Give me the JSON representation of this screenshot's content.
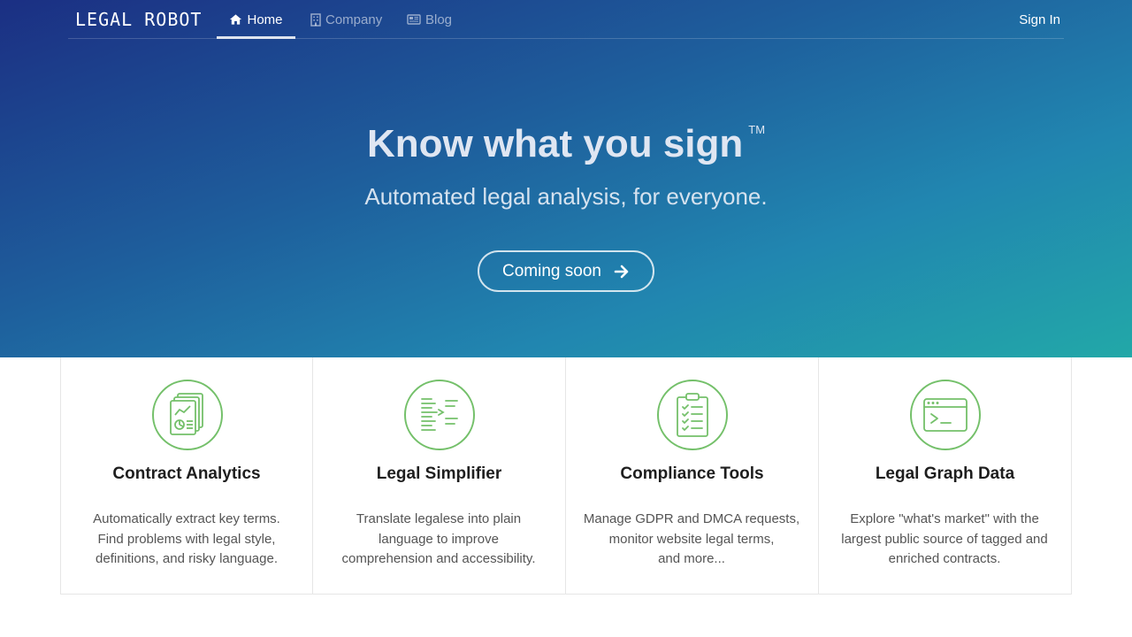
{
  "brand": {
    "logo": "LEGAL ROBOT"
  },
  "nav": {
    "items": [
      {
        "label": "Home",
        "icon": "home-icon",
        "active": true
      },
      {
        "label": "Company",
        "icon": "building-icon",
        "active": false
      },
      {
        "label": "Blog",
        "icon": "newspaper-icon",
        "active": false
      }
    ],
    "sign_in": "Sign In"
  },
  "hero": {
    "title": "Know what you sign",
    "trademark": "TM",
    "subtitle": "Automated legal analysis, for everyone.",
    "cta_label": "Coming soon",
    "cta_icon": "arrow-right-icon"
  },
  "colors": {
    "accent_green": "#74c06a",
    "hero_gradient_start": "#1b2f83",
    "hero_gradient_end": "#22a8a8"
  },
  "features": [
    {
      "title": "Contract Analytics",
      "icon": "document-chart-icon",
      "description": "Automatically extract key terms.\nFind problems with legal style,\ndefinitions, and risky language."
    },
    {
      "title": "Legal Simplifier",
      "icon": "text-simplify-icon",
      "description": "Translate legalese into plain\nlanguage to improve\ncomprehension and accessibility."
    },
    {
      "title": "Compliance Tools",
      "icon": "clipboard-checklist-icon",
      "description": "Manage GDPR and DMCA requests,\nmonitor website legal terms,\nand more..."
    },
    {
      "title": "Legal Graph Data",
      "icon": "terminal-window-icon",
      "description": "Explore \"what's market\" with the\nlargest public source of tagged and\nenriched contracts."
    }
  ]
}
